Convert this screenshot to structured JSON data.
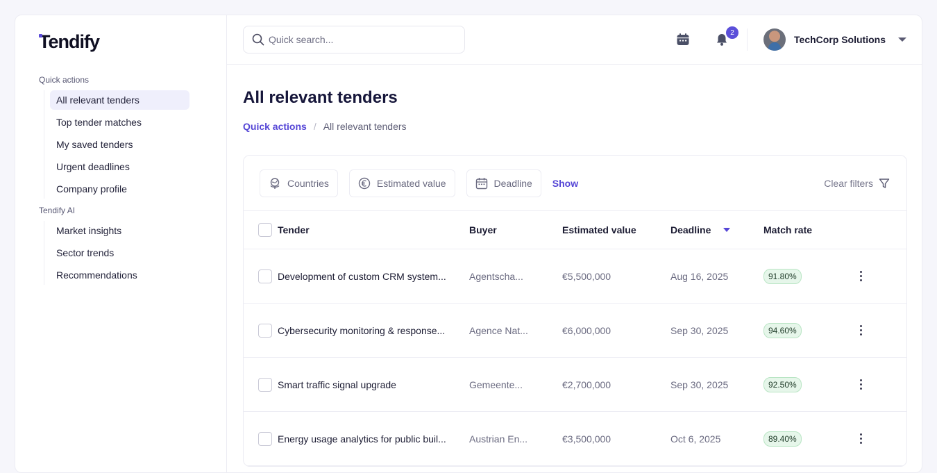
{
  "brand": {
    "logo_text": "Tendify",
    "accent": "#5546d6"
  },
  "sidebar": {
    "sections": [
      {
        "title": "Quick actions",
        "items": [
          {
            "label": "All relevant tenders",
            "active": true
          },
          {
            "label": "Top tender matches"
          },
          {
            "label": "My saved tenders"
          },
          {
            "label": "Urgent deadlines"
          },
          {
            "label": "Company profile"
          }
        ]
      },
      {
        "title": "Tendify AI",
        "items": [
          {
            "label": "Market insights"
          },
          {
            "label": "Sector trends"
          },
          {
            "label": "Recommendations"
          }
        ]
      }
    ]
  },
  "topbar": {
    "search_placeholder": "Quick search...",
    "notification_count": "2",
    "user_name": "TechCorp Solutions",
    "icons": [
      "search-icon",
      "calendar-icon",
      "bell-icon",
      "chevron-down-icon"
    ]
  },
  "page": {
    "title": "All relevant tenders",
    "breadcrumb": {
      "link": "Quick actions",
      "separator": "/",
      "current": "All relevant tenders"
    }
  },
  "filters": {
    "countries": "Countries",
    "estimated_value": "Estimated value",
    "deadline": "Deadline",
    "show": "Show",
    "clear": "Clear filters"
  },
  "table": {
    "headers": {
      "tender": "Tender",
      "buyer": "Buyer",
      "value": "Estimated value",
      "deadline": "Deadline",
      "match": "Match rate"
    },
    "rows": [
      {
        "tender": "Development of custom CRM system...",
        "buyer": "Agentscha...",
        "value": "€5,500,000",
        "deadline": "Aug 16, 2025",
        "match": "91.80%"
      },
      {
        "tender": "Cybersecurity monitoring & response...",
        "buyer": "Agence Nat...",
        "value": "€6,000,000",
        "deadline": "Sep 30, 2025",
        "match": "94.60%"
      },
      {
        "tender": "Smart traffic signal upgrade",
        "buyer": "Gemeente...",
        "value": "€2,700,000",
        "deadline": "Sep 30, 2025",
        "match": "92.50%"
      },
      {
        "tender": "Energy usage analytics for public buil...",
        "buyer": "Austrian En...",
        "value": "€3,500,000",
        "deadline": "Oct 6, 2025",
        "match": "89.40%"
      }
    ]
  }
}
